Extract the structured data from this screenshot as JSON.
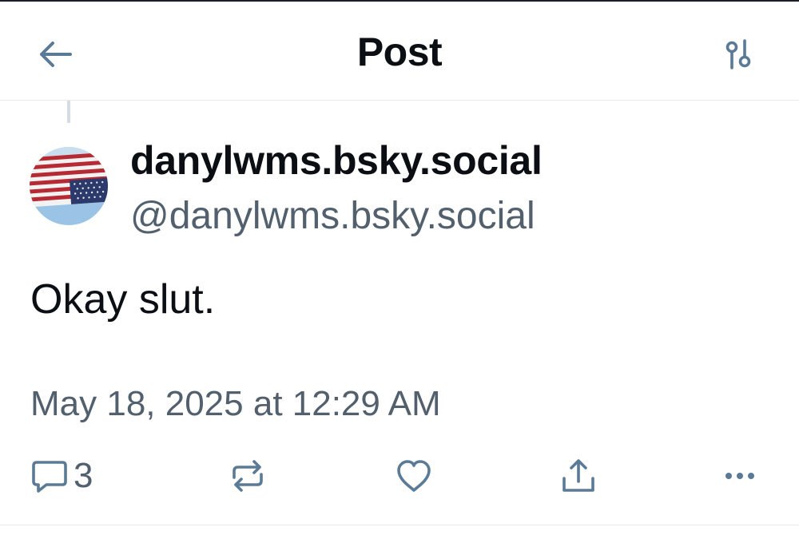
{
  "header": {
    "title": "Post",
    "back_icon": "arrow-left-icon",
    "filter_icon": "sliders-icon"
  },
  "post": {
    "author": {
      "display_name": "danylwms.bsky.social",
      "handle": "@danylwms.bsky.social",
      "avatar": "upside-down-us-flag-image"
    },
    "text": "Okay slut.",
    "timestamp": "May 18, 2025 at 12:29 AM",
    "actions": {
      "reply_count": "3",
      "reply_icon": "speech-bubble-icon",
      "repost_icon": "repost-arrows-icon",
      "like_icon": "heart-icon",
      "share_icon": "share-upload-icon",
      "more_icon": "ellipsis-icon"
    }
  },
  "colors": {
    "text": "#0b0f14",
    "muted": "#52606e",
    "icon": "#5b7a95",
    "divider": "#e6eaef"
  }
}
